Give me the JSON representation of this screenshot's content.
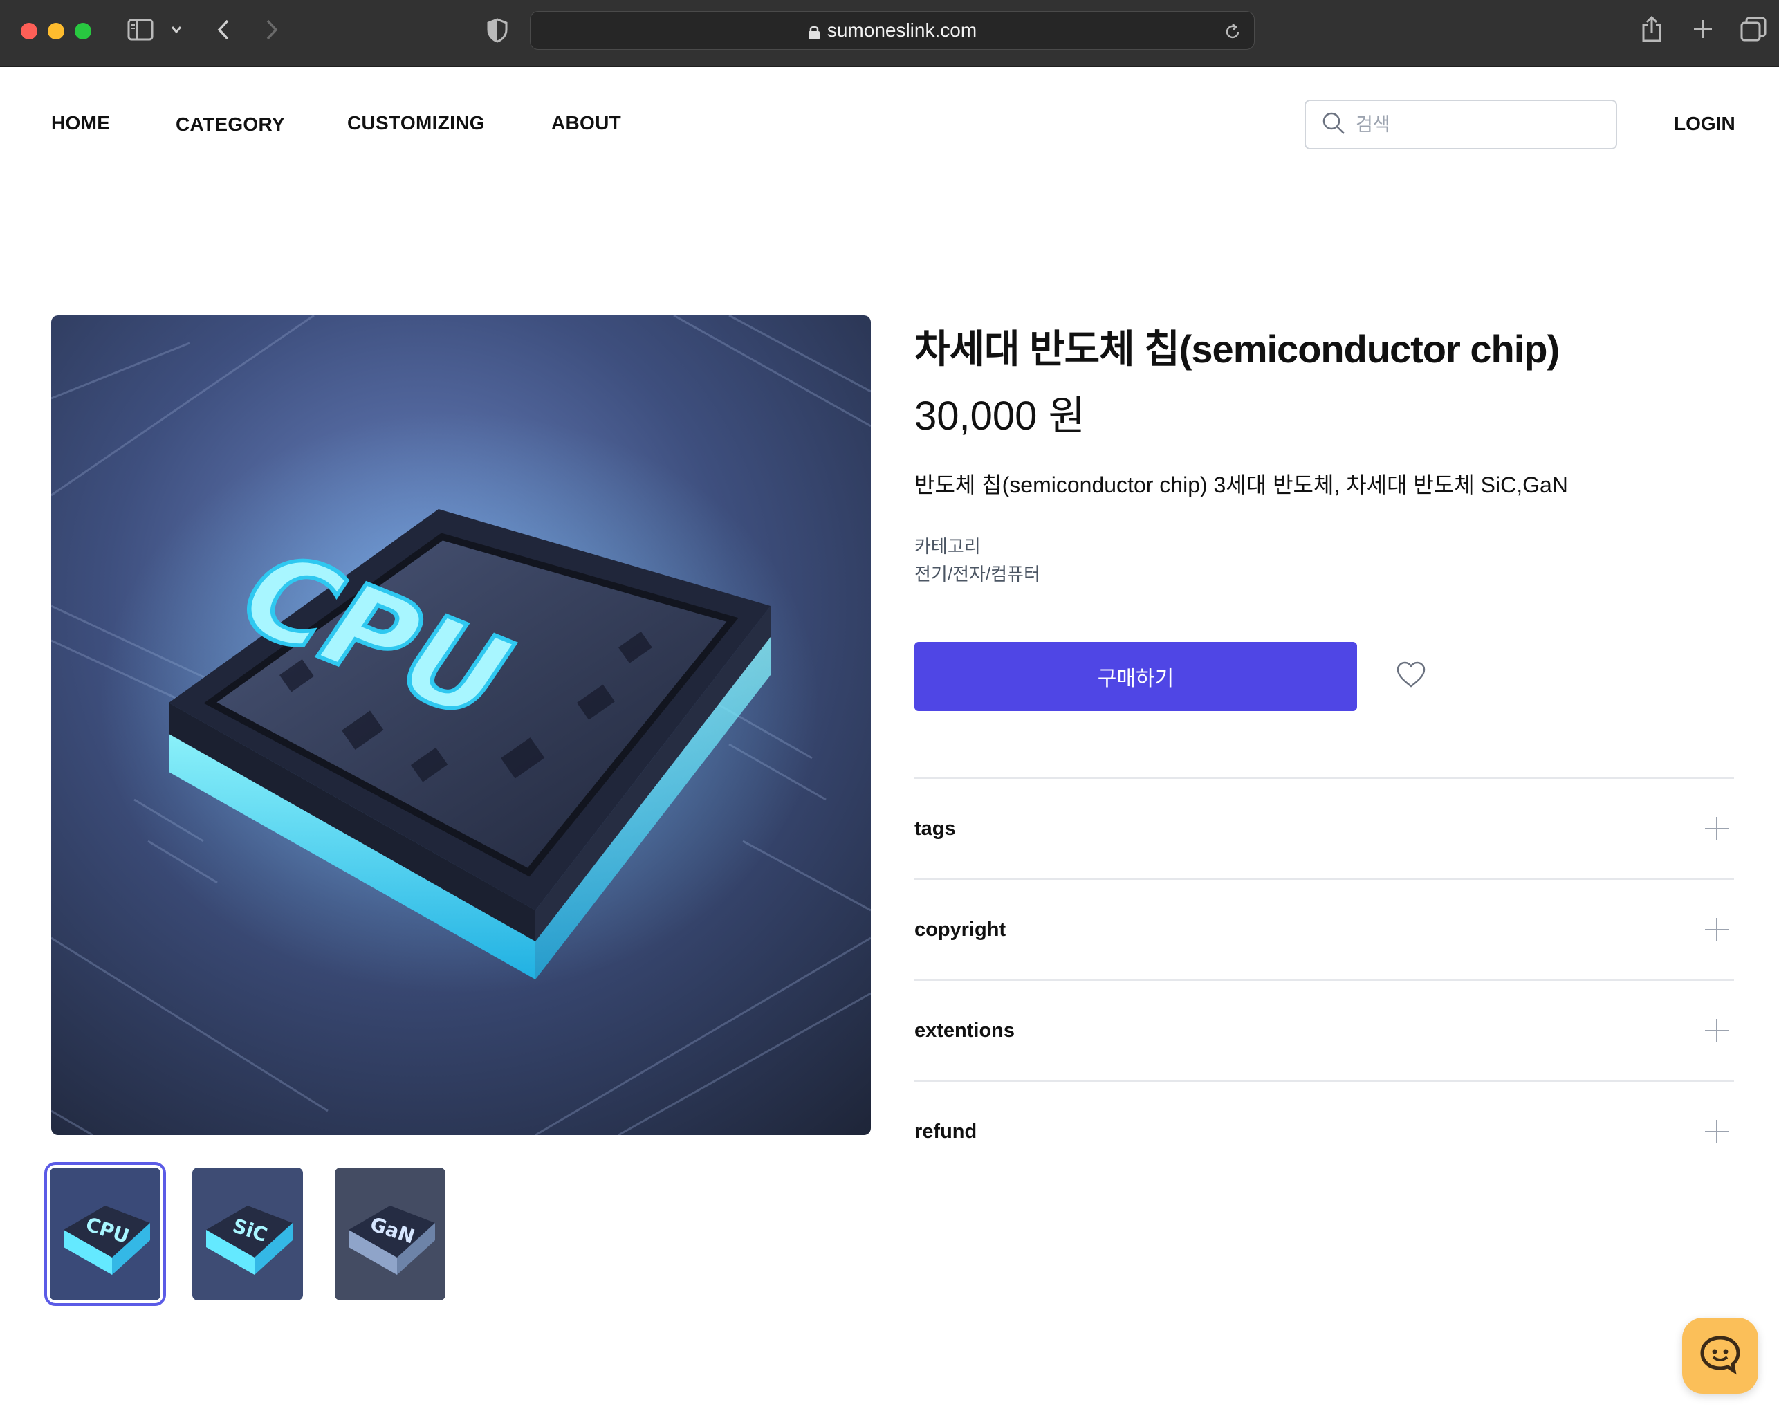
{
  "browser": {
    "url": "sumoneslink.com"
  },
  "nav": {
    "items": [
      {
        "label": "HOME"
      },
      {
        "label": "CATEGORY"
      },
      {
        "label": "CUSTOMIZING"
      },
      {
        "label": "ABOUT"
      }
    ],
    "search_placeholder": "검색",
    "login": "LOGIN"
  },
  "product": {
    "title": "차세대 반도체 칩(semiconductor chip)",
    "price": "30,000 원",
    "description": "반도체 칩(semiconductor chip) 3세대 반도체, 차세대 반도체 SiC,GaN",
    "category_label": "카테고리",
    "category_value": "전기/전자/컴퓨터",
    "buy_label": "구매하기",
    "main_image_text": "CPU",
    "thumbnails": [
      {
        "text": "CPU",
        "active": true
      },
      {
        "text": "SiC",
        "active": false
      },
      {
        "text": "GaN",
        "active": false
      }
    ],
    "accordion": [
      {
        "label": "tags"
      },
      {
        "label": "copyright"
      },
      {
        "label": "extentions"
      },
      {
        "label": "refund"
      }
    ]
  },
  "colors": {
    "accent": "#4f46e5",
    "chat_button": "#fbbf59"
  }
}
